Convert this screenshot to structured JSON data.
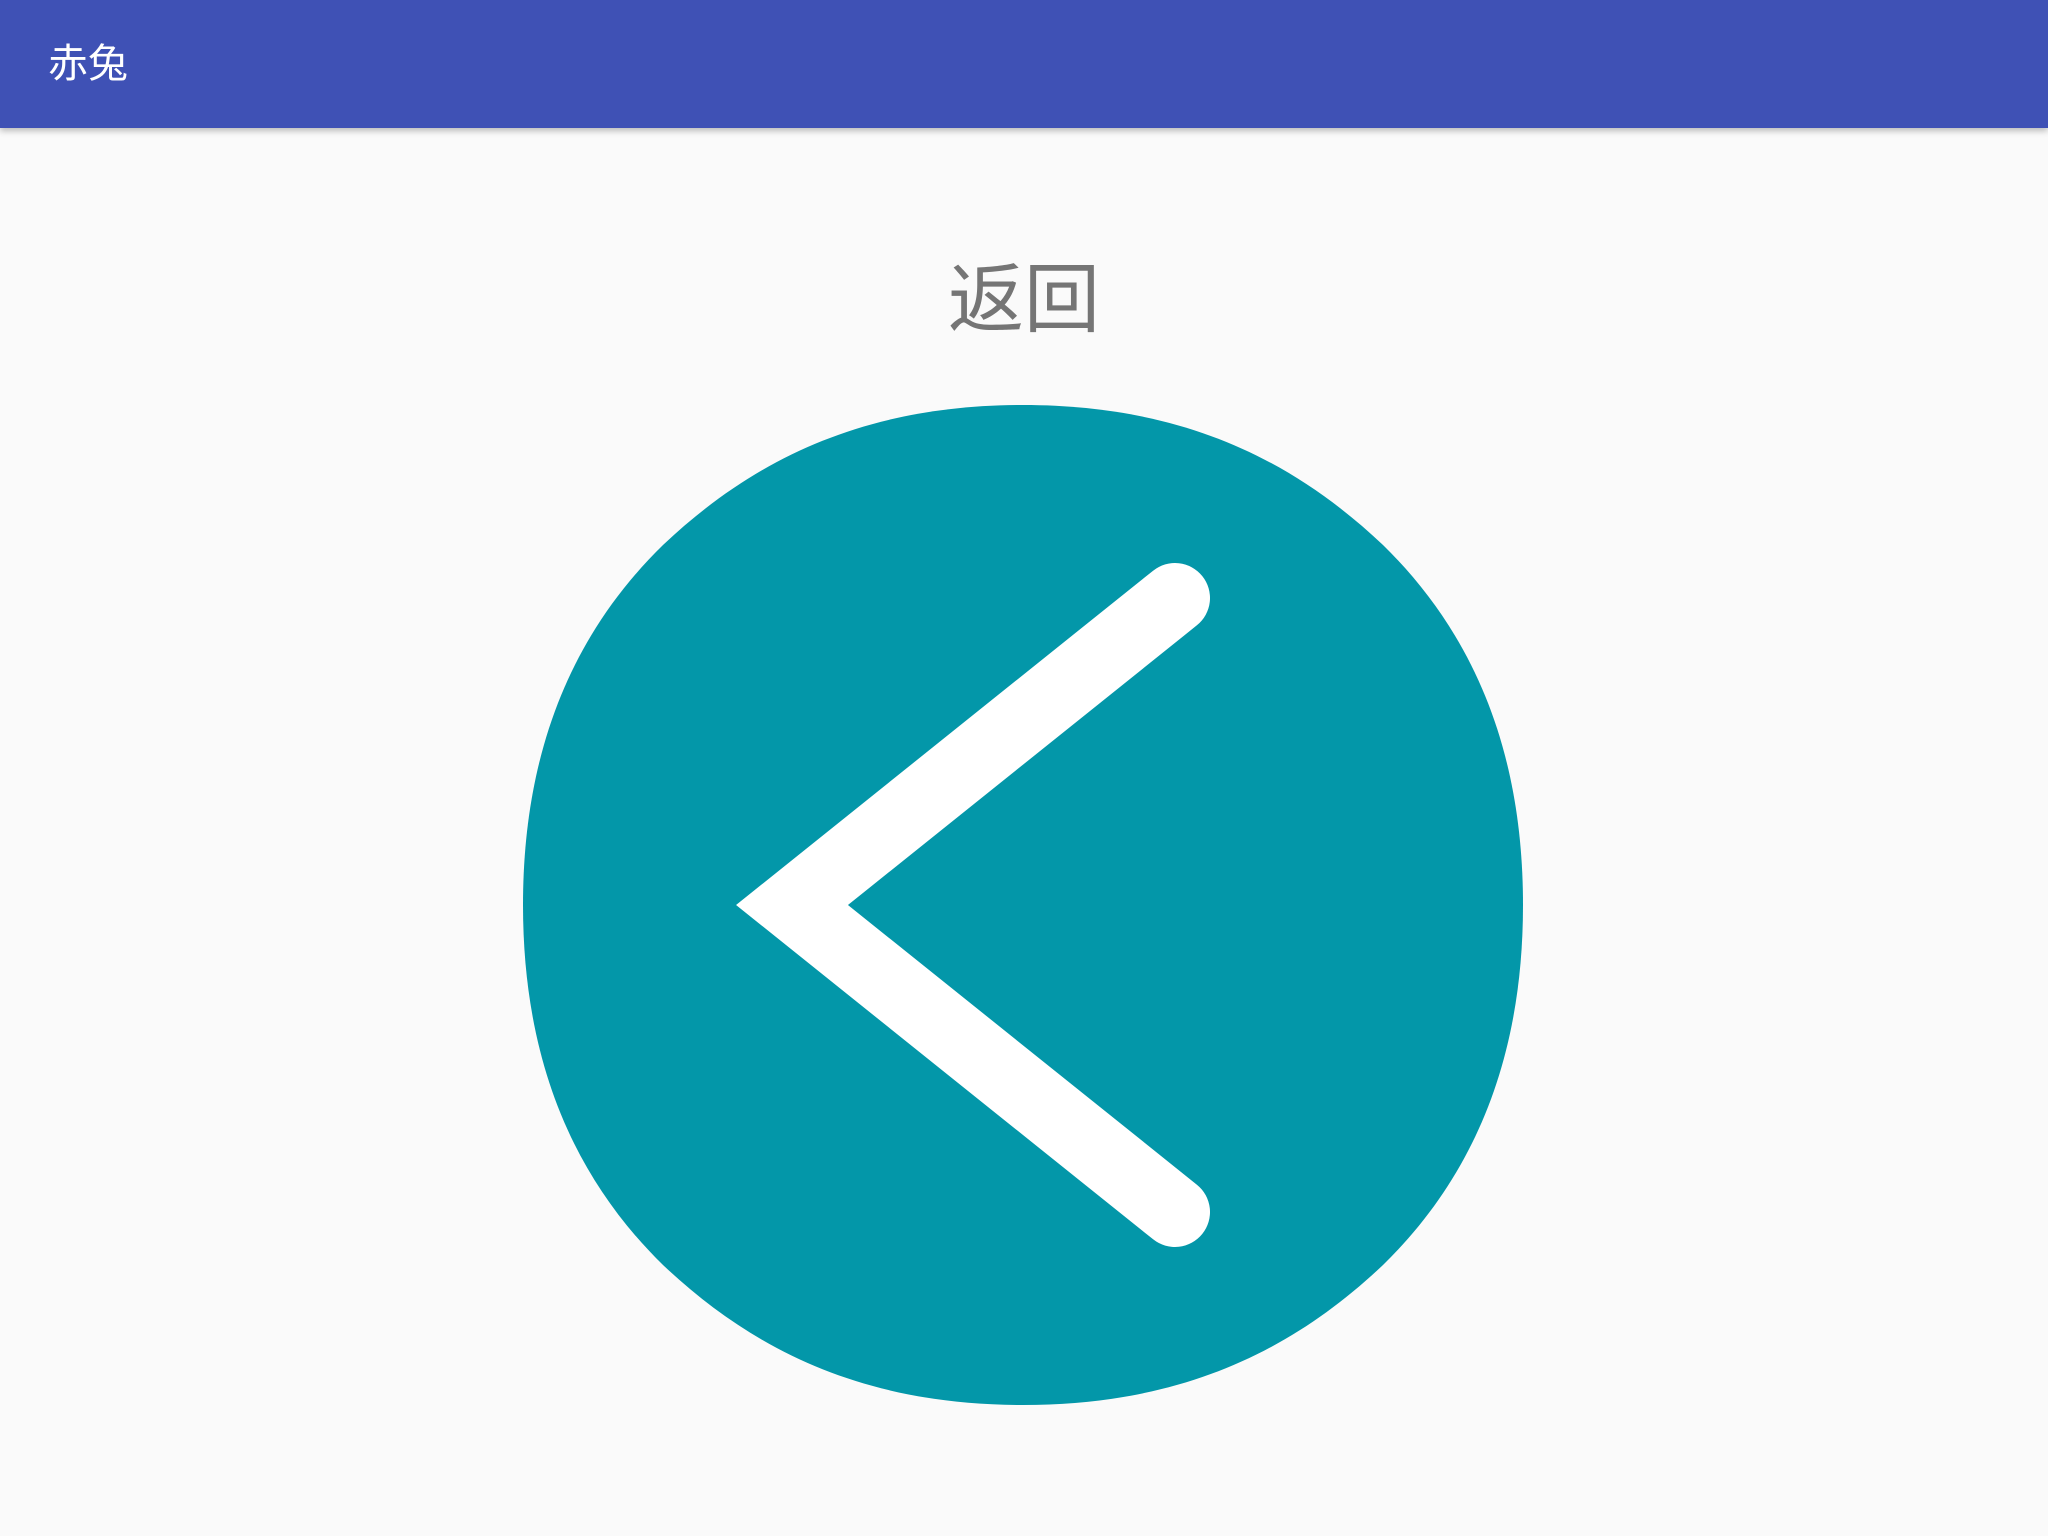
{
  "app_bar": {
    "title": "赤兔",
    "background_color": "#3f51b5",
    "title_color": "#ffffff"
  },
  "main": {
    "back_label": "返回",
    "back_label_color": "#757575",
    "back_button": {
      "icon": "chevron-left-icon",
      "fill_color": "#0397a9",
      "icon_color": "#ffffff"
    }
  }
}
